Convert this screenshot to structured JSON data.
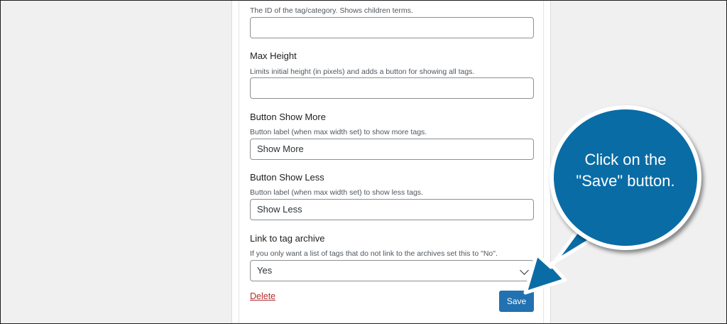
{
  "fields": [
    {
      "label": "",
      "description": "The ID of the tag/category. Shows children terms.",
      "value": ""
    },
    {
      "label": "Max Height",
      "description": "Limits initial height (in pixels) and adds a button for showing all tags.",
      "value": ""
    },
    {
      "label": "Button Show More",
      "description": "Button label (when max width set) to show more tags.",
      "value": "Show More"
    },
    {
      "label": "Button Show Less",
      "description": "Button label (when max width set) to show less tags.",
      "value": "Show Less"
    },
    {
      "label": "Link to tag archive",
      "description": "If you only want a list of tags that do not link to the archives set this to \"No\".",
      "value": "Yes"
    }
  ],
  "actions": {
    "delete_label": "Delete",
    "save_label": "Save"
  },
  "callout": {
    "line1": "Click on the",
    "line2": "\"Save\" button."
  },
  "colors": {
    "accent": "#2271b1",
    "delete": "#b32d2e",
    "callout": "#0a6ca5"
  }
}
